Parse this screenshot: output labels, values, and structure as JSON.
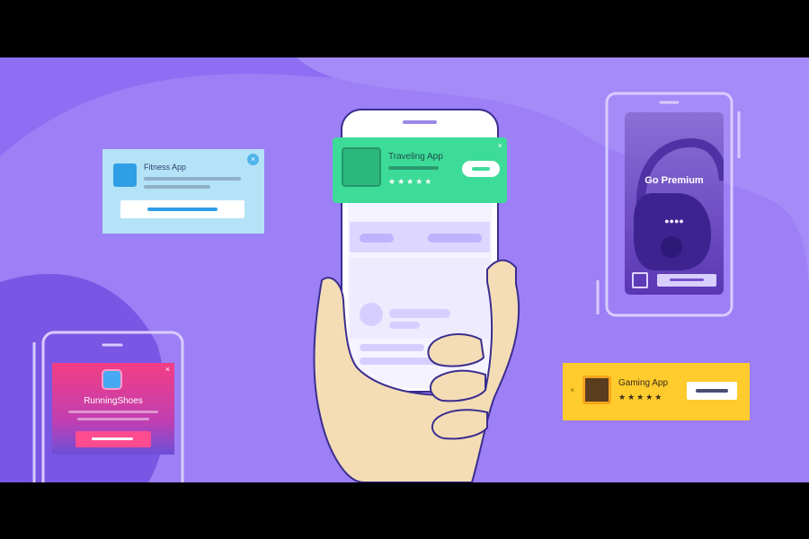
{
  "cards": {
    "fitness": {
      "title": "Fitness App",
      "close": "×"
    },
    "travel": {
      "title": "Traveling App",
      "stars": "★★★★★",
      "close": "×"
    },
    "gaming": {
      "title": "Gaming App",
      "stars": "★★★★★",
      "close": "×"
    },
    "premium": {
      "title": "Go Premium",
      "dots": "●●●●"
    },
    "running": {
      "title": "RunningShoes",
      "close": "×"
    }
  },
  "colors": {
    "background": "#8e6ef2",
    "travel_card": "#3ddb98",
    "fitness_card": "#b4e3f7",
    "gaming_card": "#ffcb2d",
    "running_card": "#f33e83"
  },
  "icons": [
    "map-pin-icon",
    "fitness-icon",
    "cards-icon",
    "gear-icon",
    "shoe-icon"
  ]
}
